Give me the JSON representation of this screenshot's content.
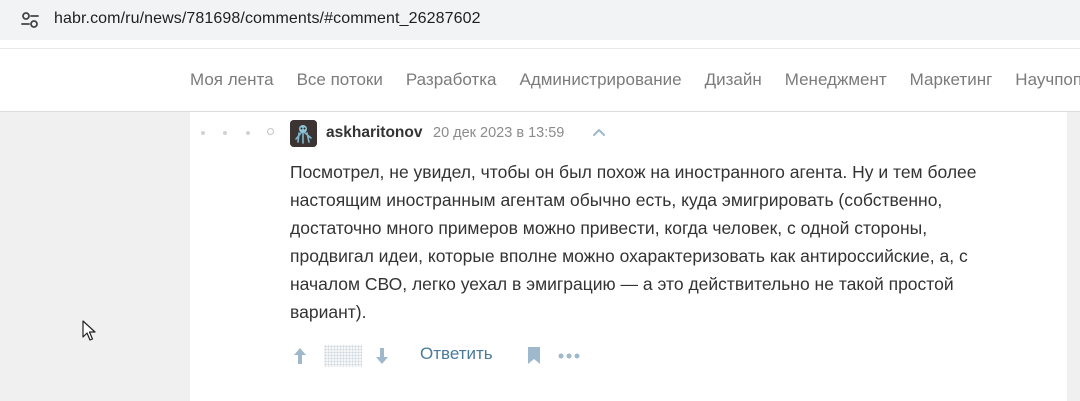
{
  "browser": {
    "url": "habr.com/ru/news/781698/comments/#comment_26287602"
  },
  "nav": {
    "items": [
      "Моя лента",
      "Все потоки",
      "Разработка",
      "Администрирование",
      "Дизайн",
      "Менеджмент",
      "Маркетинг",
      "Научпоп"
    ]
  },
  "comment": {
    "author": "askharitonov",
    "timestamp": "20 дек 2023 в 13:59",
    "lines": [
      "Посмотрел, не увидел, чтобы он был похож на иностранного агента. Ну и тем более",
      "настоящим иностранным агентам обычно есть, куда эмигрировать (собственно,",
      "достаточно много примеров можно привести, когда человек, с одной стороны,",
      "продвигал идеи, которые вполне можно охарактеризовать как антироссийские, а, с",
      "началом СВО, легко уехал в эмиграцию — а это действительно не такой простой",
      "вариант)."
    ],
    "reply_label": "Ответить"
  },
  "icons": {
    "site_settings": "site-settings-icon",
    "vote_up": "arrow-up-icon",
    "vote_down": "arrow-down-icon",
    "bookmark": "bookmark-icon",
    "more": "more-dots-icon",
    "parent": "chevron-up-icon"
  },
  "colors": {
    "link": "#4a7a9c",
    "vote_icon": "#9fb9cc",
    "nav_text": "#7b7b7b",
    "gutter": "#f0f0f0"
  }
}
